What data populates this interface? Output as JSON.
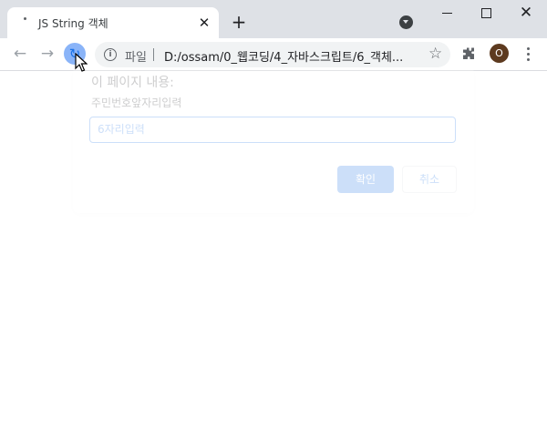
{
  "tab": {
    "title": "JS String 객체",
    "close_glyph": "✕"
  },
  "new_tab_glyph": "+",
  "window": {
    "close_glyph": "✕"
  },
  "toolbar": {
    "back_glyph": "←",
    "forward_glyph": "→",
    "reload_glyph": "↻",
    "info_glyph": "i",
    "scheme_label": "파일",
    "url": "D:/ossam/0_웹코딩/4_자바스크립트/6_객체...",
    "star_glyph": "☆",
    "profile_initial": "O"
  },
  "dialog": {
    "title": "이 페이지 내용:",
    "message": "주민번호앞자리입력",
    "input_value": "6자리입력",
    "ok_label": "확인",
    "cancel_label": "취소"
  },
  "colors": {
    "tabstrip": "#dee1e6",
    "accent": "#1a73e8",
    "reload_highlight": "#8ab4f8",
    "avatar": "#5d3a1f"
  }
}
